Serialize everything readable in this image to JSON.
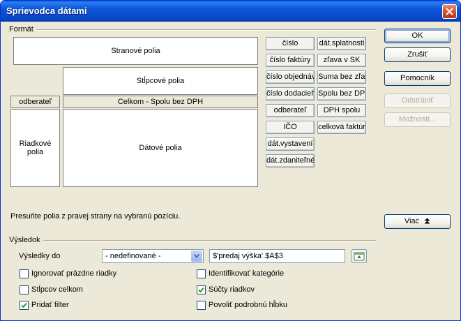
{
  "window": {
    "title": "Sprievodca dátami"
  },
  "format": {
    "section_label": "Formát",
    "page_area": "Stranové polia",
    "column_area": "Stĺpcové polia",
    "row_header": "odberateľ",
    "data_header": "Celkom - Spolu bez DPH",
    "row_area": "Riadkové polia",
    "data_area": "Dátové polia",
    "hint": "Presuňte polia z pravej strany na vybranú pozíciu."
  },
  "fields": {
    "col1": [
      "číslo",
      "číslo faktúry",
      "číslo objednáv",
      "číslo dodacieho",
      "odberateľ",
      "IČO",
      "dát.vystavení",
      "dát.zdaniteľné"
    ],
    "col2": [
      "dát.splatnosti",
      "zľava v SK",
      "Suma bez zľav",
      "Spolu bez DPH",
      "DPH spolu",
      "celková faktúr"
    ]
  },
  "buttons": {
    "ok": "OK",
    "cancel": "Zrušiť",
    "help": "Pomocník",
    "remove": "Odstrániť",
    "options": "Možnosti...",
    "more": "Viac"
  },
  "result": {
    "section_label": "Výsledok",
    "output_label": "Výsledky do",
    "output_select": "- nedefinované -",
    "output_value": "$'predaj výška'.$A$3"
  },
  "options": {
    "ignore_empty": {
      "label": "Ignorovať prázdne riadky",
      "checked": false
    },
    "identify_categories": {
      "label": "Identifikovať kategórie",
      "checked": false
    },
    "column_totals": {
      "label": "Stĺpcov celkom",
      "checked": false
    },
    "row_totals": {
      "label": "Súčty riadkov",
      "checked": true
    },
    "add_filter": {
      "label": "Pridať filter",
      "checked": true
    },
    "enable_drilldown": {
      "label": "Povoliť podrobnú hĺbku",
      "checked": false
    }
  },
  "colors": {
    "titlebar": "#0a56d6",
    "dialog_bg": "#ece9d8",
    "check": "#21a121"
  }
}
